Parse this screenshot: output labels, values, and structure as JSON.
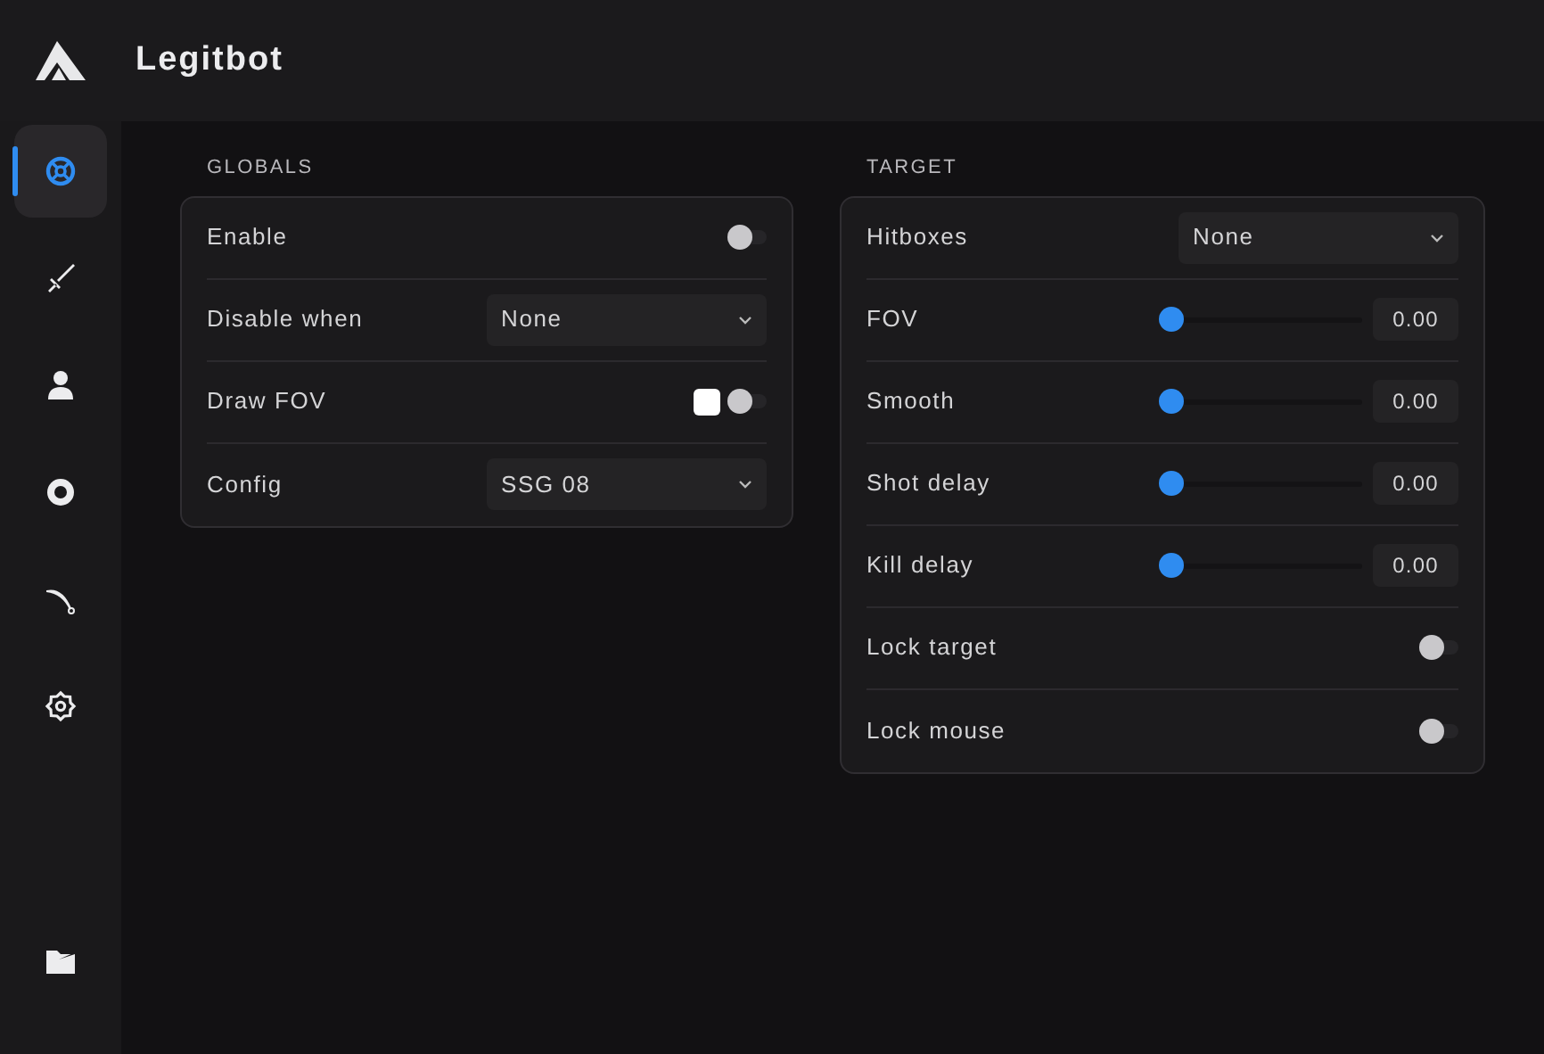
{
  "header": {
    "title": "Legitbot"
  },
  "sidebar": {
    "items": [
      {
        "kind": "crosshair",
        "selected": true
      },
      {
        "kind": "sword",
        "selected": false
      },
      {
        "kind": "person",
        "selected": false
      },
      {
        "kind": "eye",
        "selected": false
      },
      {
        "kind": "blade",
        "selected": false
      },
      {
        "kind": "gear",
        "selected": false
      }
    ],
    "bottom_item": {
      "kind": "folder",
      "selected": false
    }
  },
  "panels": [
    {
      "title": "GLOBALS",
      "rows": [
        {
          "kind": "toggle",
          "label": "Enable",
          "on": false
        },
        {
          "kind": "select",
          "label": "Disable when",
          "value": "None"
        },
        {
          "kind": "color_toggle",
          "label": "Draw FOV",
          "color": "#ffffff",
          "on": false
        },
        {
          "kind": "select",
          "label": "Config",
          "value": "SSG 08"
        }
      ]
    },
    {
      "title": "TARGET",
      "rows": [
        {
          "kind": "select",
          "label": "Hitboxes",
          "value": "None"
        },
        {
          "kind": "slider",
          "label": "FOV",
          "level": 0,
          "reading": "0.00"
        },
        {
          "kind": "slider",
          "label": "Smooth",
          "level": 0,
          "reading": "0.00"
        },
        {
          "kind": "slider",
          "label": "Shot delay",
          "level": 0,
          "reading": "0.00"
        },
        {
          "kind": "slider",
          "label": "Kill delay",
          "level": 0,
          "reading": "0.00"
        },
        {
          "kind": "toggle",
          "label": "Lock target",
          "on": false
        },
        {
          "kind": "toggle",
          "label": "Lock mouse",
          "on": false
        }
      ]
    }
  ]
}
